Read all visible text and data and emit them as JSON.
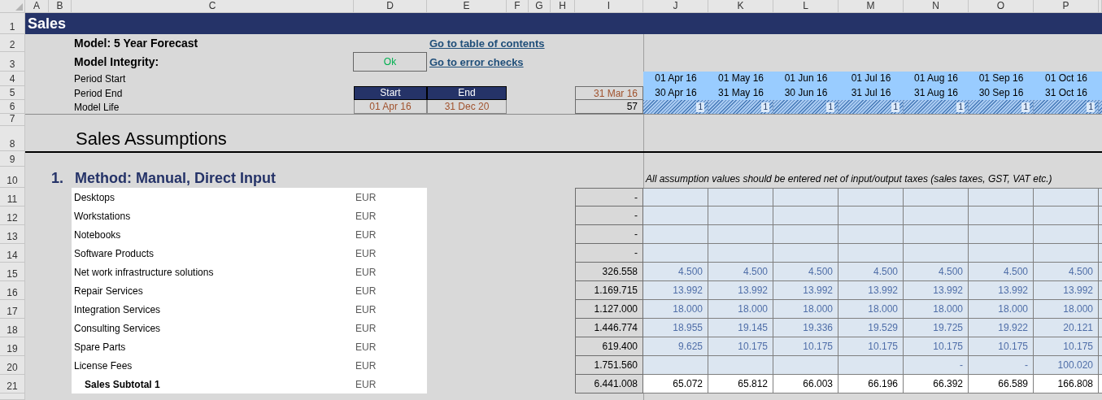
{
  "column_headers": [
    "A",
    "B",
    "C",
    "D",
    "E",
    "F",
    "G",
    "H",
    "I",
    "J",
    "K",
    "L",
    "M",
    "N",
    "O",
    "P"
  ],
  "row_numbers": [
    "1",
    "2",
    "3",
    "4",
    "5",
    "6",
    "7",
    "8",
    "9",
    "10",
    "11",
    "12",
    "13",
    "14",
    "15",
    "16",
    "17",
    "18",
    "19",
    "20",
    "21"
  ],
  "sheet_title": "Sales",
  "model": "Model: 5 Year Forecast",
  "model_integrity": {
    "label": "Model Integrity:",
    "status": "Ok"
  },
  "links": [
    "Go to table of contents",
    "Go to error checks"
  ],
  "period_labels": [
    "Period Start",
    "Period End",
    "Model Life"
  ],
  "model_dates": {
    "headers": [
      "Start",
      "End"
    ],
    "values": [
      "01 Apr 16",
      "31 Dec 20"
    ],
    "opening_date": "31 Mar 16",
    "model_life": "57"
  },
  "periods": [
    {
      "start": "01 Apr 16",
      "end": "30 Apr 16",
      "flag": "1"
    },
    {
      "start": "01 May 16",
      "end": "31 May 16",
      "flag": "1"
    },
    {
      "start": "01 Jun 16",
      "end": "30 Jun 16",
      "flag": "1"
    },
    {
      "start": "01 Jul 16",
      "end": "31 Jul 16",
      "flag": "1"
    },
    {
      "start": "01 Aug 16",
      "end": "31 Aug 16",
      "flag": "1"
    },
    {
      "start": "01 Sep 16",
      "end": "30 Sep 16",
      "flag": "1"
    },
    {
      "start": "01 Oct 16",
      "end": "31 Oct 16",
      "flag": "1"
    }
  ],
  "section_title": "Sales Assumptions",
  "method": {
    "number": "1.",
    "title": "Method: Manual, Direct Input"
  },
  "note": "All assumption values should be entered net of input/output taxes (sales taxes, GST, VAT etc.)",
  "rows": [
    {
      "kind": "input",
      "label": "Desktops",
      "unit": "EUR",
      "total": "-"
    },
    {
      "kind": "input",
      "label": "Workstations",
      "unit": "EUR",
      "total": "-"
    },
    {
      "kind": "input",
      "label": "Notebooks",
      "unit": "EUR",
      "total": "-"
    },
    {
      "kind": "input",
      "label": "Software Products",
      "unit": "EUR",
      "total": "-"
    },
    {
      "kind": "input",
      "label": "Net work infrastructure solutions",
      "unit": "EUR",
      "total": "326.558",
      "values": [
        "4.500",
        "4.500",
        "4.500",
        "4.500",
        "4.500",
        "4.500",
        "4.500"
      ]
    },
    {
      "kind": "input",
      "label": "Repair Services",
      "unit": "EUR",
      "total": "1.169.715",
      "values": [
        "13.992",
        "13.992",
        "13.992",
        "13.992",
        "13.992",
        "13.992",
        "13.992"
      ]
    },
    {
      "kind": "input",
      "label": "Integration Services",
      "unit": "EUR",
      "total": "1.127.000",
      "values": [
        "18.000",
        "18.000",
        "18.000",
        "18.000",
        "18.000",
        "18.000",
        "18.000"
      ]
    },
    {
      "kind": "input",
      "label": "Consulting Services",
      "unit": "EUR",
      "total": "1.446.774",
      "values": [
        "18.955",
        "19.145",
        "19.336",
        "19.529",
        "19.725",
        "19.922",
        "20.121"
      ]
    },
    {
      "kind": "input",
      "label": "Spare Parts",
      "unit": "EUR",
      "total": "619.400",
      "values": [
        "9.625",
        "10.175",
        "10.175",
        "10.175",
        "10.175",
        "10.175",
        "10.175"
      ]
    },
    {
      "kind": "input",
      "label": "License Fees",
      "unit": "EUR",
      "total": "1.751.560",
      "values": [
        "-",
        "-",
        "100.020"
      ]
    },
    {
      "kind": "subtotal",
      "label": "Sales Subtotal 1",
      "unit": "EUR",
      "total": "6.441.008",
      "values": [
        "65.072",
        "65.812",
        "66.003",
        "66.196",
        "66.392",
        "66.589",
        "166.808"
      ]
    }
  ]
}
